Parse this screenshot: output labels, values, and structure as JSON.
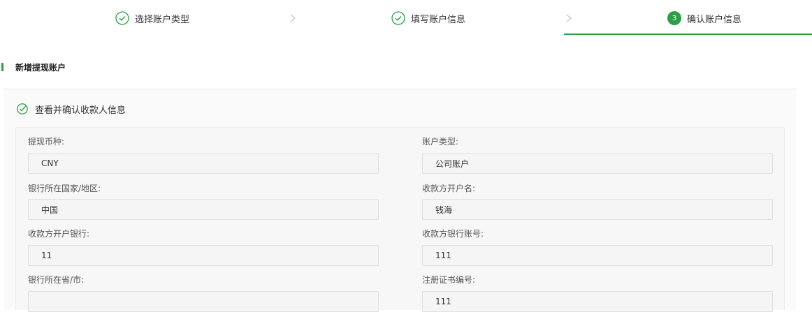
{
  "stepper": {
    "steps": [
      {
        "label": "选择账户类型",
        "state": "done"
      },
      {
        "label": "填写账户信息",
        "state": "done"
      },
      {
        "label": "确认账户信息",
        "state": "active",
        "number": "3"
      }
    ]
  },
  "section": {
    "title": "新增提现账户"
  },
  "confirm": {
    "heading": "查看并确认收款人信息"
  },
  "fields": {
    "currency": {
      "label": "提现币种:",
      "value": "CNY"
    },
    "account_type": {
      "label": "账户类型:",
      "value": "公司账户"
    },
    "bank_country": {
      "label": "银行所在国家/地区:",
      "value": "中国"
    },
    "payee_name": {
      "label": "收款方开户名:",
      "value": "钱海"
    },
    "payee_bank": {
      "label": "收款方开户银行:",
      "value": "11"
    },
    "payee_account": {
      "label": "收款方银行账号:",
      "value": "111"
    },
    "bank_province_city": {
      "label": "银行所在省/市:",
      "value": ""
    },
    "registration_no": {
      "label": "注册证书编号:",
      "value": "111"
    }
  },
  "colors": {
    "accent": "#2e9e47"
  }
}
